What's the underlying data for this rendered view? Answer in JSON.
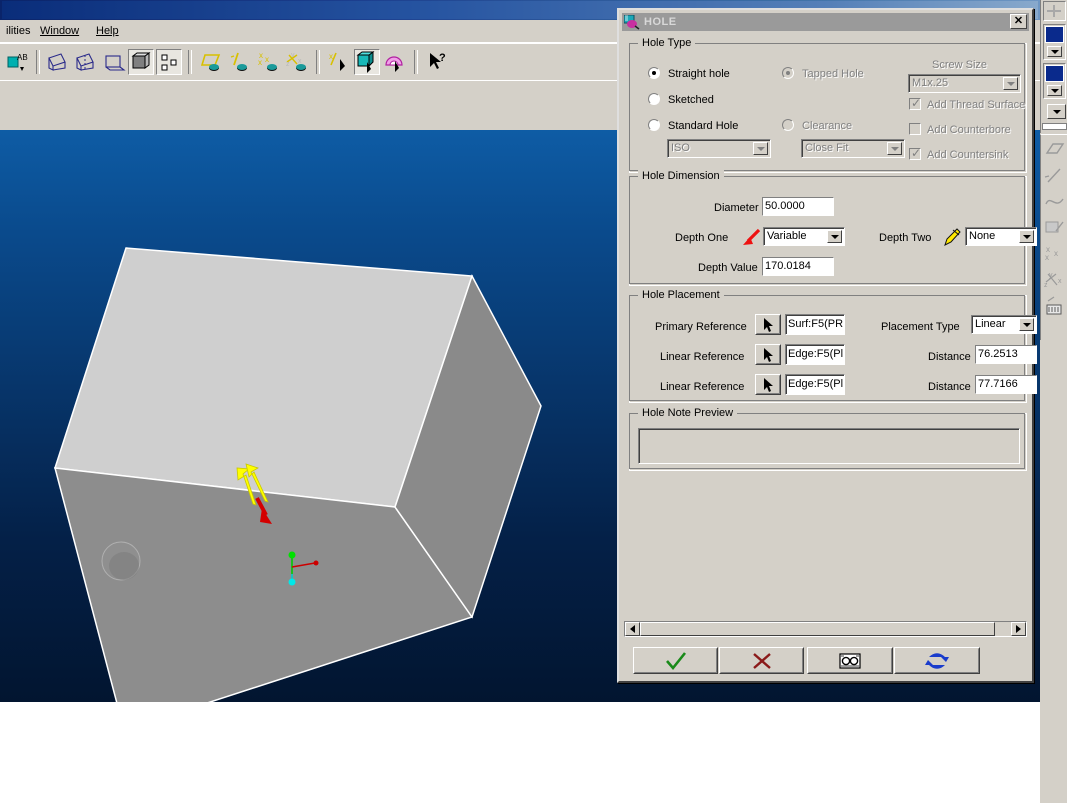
{
  "app": {
    "menu": [
      {
        "label": "ilities",
        "accel": ""
      },
      {
        "label": "Window",
        "accel": "W"
      },
      {
        "label": "Help",
        "accel": "H"
      }
    ],
    "toolbar_icons": [
      "text-annotation-icon",
      "datum-plane-icon",
      "datum-axis-icon",
      "datum-point-icon",
      "shaded-display-icon",
      "wireframe-display-icon",
      "datum-plane-display-icon",
      "datum-axis-display-icon",
      "datum-point-display-icon",
      "datum-csys-display-icon",
      "spin-center-icon",
      "zoom-box-icon",
      "refit-icon",
      "help-pointer-icon"
    ],
    "right_panel_icons": [
      "color-swatch-combo",
      "color-swatch-combo-2",
      "layer-dropdown",
      "plane-icon",
      "line-icon",
      "spline-icon",
      "point-cloud-icon",
      "datum-point-icon",
      "datum-csys-icon",
      "analysis-icon"
    ]
  },
  "viewport": {
    "background_top": "#0e5ca5",
    "background_bottom": "#021530",
    "model": {
      "name": "rectangular-block-with-hole",
      "top_face_color": "#cfcfcf",
      "front_face_color": "#919191",
      "side_face_color": "#8a8a8a",
      "edge_color": "#ffffff",
      "hole_color": "#8b8b8b"
    },
    "annotations": {
      "depth_arrow_color": "#ff0000",
      "direction_arrow_color": "#ffff00",
      "csys_x_color": "#cc0000",
      "csys_y_color": "#00e000",
      "csys_z_color": "#00e0e0"
    }
  },
  "dialog": {
    "title": "HOLE",
    "title_icon": "hole-feature-icon",
    "close_label": "✕",
    "hole_type": {
      "group_label": "Hole Type",
      "options": [
        {
          "label": "Straight hole",
          "selected": true,
          "enabled": true
        },
        {
          "label": "Sketched",
          "selected": false,
          "enabled": true
        },
        {
          "label": "Standard Hole",
          "selected": false,
          "enabled": true
        },
        {
          "label": "Tapped Hole",
          "selected": true,
          "enabled": false
        },
        {
          "label": "Clearance",
          "selected": false,
          "enabled": false
        }
      ],
      "standard_combo": {
        "value": "ISO",
        "enabled": false
      },
      "fit_combo": {
        "value": "Close Fit",
        "enabled": false
      },
      "screw_size_label": "Screw Size",
      "screw_size_combo": {
        "value": "M1x.25",
        "enabled": false
      },
      "checkboxes": [
        {
          "label": "Add Thread Surface",
          "checked": true,
          "enabled": false
        },
        {
          "label": "Add Counterbore",
          "checked": false,
          "enabled": false
        },
        {
          "label": "Add Countersink",
          "checked": true,
          "enabled": false
        }
      ]
    },
    "hole_dimension": {
      "group_label": "Hole Dimension",
      "diameter_label": "Diameter",
      "diameter_value": "50.0000",
      "depth_one_label": "Depth One",
      "depth_one_icon": "red-arrow-icon",
      "depth_one_value": "Variable",
      "depth_two_label": "Depth Two",
      "depth_two_icon": "yellow-arrow-icon",
      "depth_two_value": "None",
      "depth_value_label": "Depth Value",
      "depth_value": "170.0184"
    },
    "hole_placement": {
      "group_label": "Hole Placement",
      "rows": [
        {
          "label": "Primary Reference",
          "pick_icon": "select-arrow-icon",
          "value": "Surf:F5(PR"
        },
        {
          "label": "Linear Reference",
          "pick_icon": "select-arrow-icon",
          "value": "Edge:F5(Pl"
        },
        {
          "label": "Linear Reference",
          "pick_icon": "select-arrow-icon",
          "value": "Edge:F5(Pl"
        }
      ],
      "placement_type_label": "Placement Type",
      "placement_type_value": "Linear",
      "distance_one_label": "Distance",
      "distance_one_value": "76.2513",
      "distance_two_label": "Distance",
      "distance_two_value": "77.7166"
    },
    "hole_note_preview": {
      "group_label": "Hole Note Preview",
      "text": ""
    },
    "buttons": [
      {
        "name": "accept-button",
        "icon": "green-check-icon",
        "color": "#1a8a1a"
      },
      {
        "name": "cancel-button",
        "icon": "red-x-icon",
        "color": "#8b1a1a"
      },
      {
        "name": "preview-button",
        "icon": "preview-glasses-icon",
        "color": "#000000"
      },
      {
        "name": "rebuild-button",
        "icon": "blue-refresh-icon",
        "color": "#1a3ccc"
      }
    ],
    "scrollbar": {
      "left_label": "◀",
      "right_label": "▶"
    }
  }
}
